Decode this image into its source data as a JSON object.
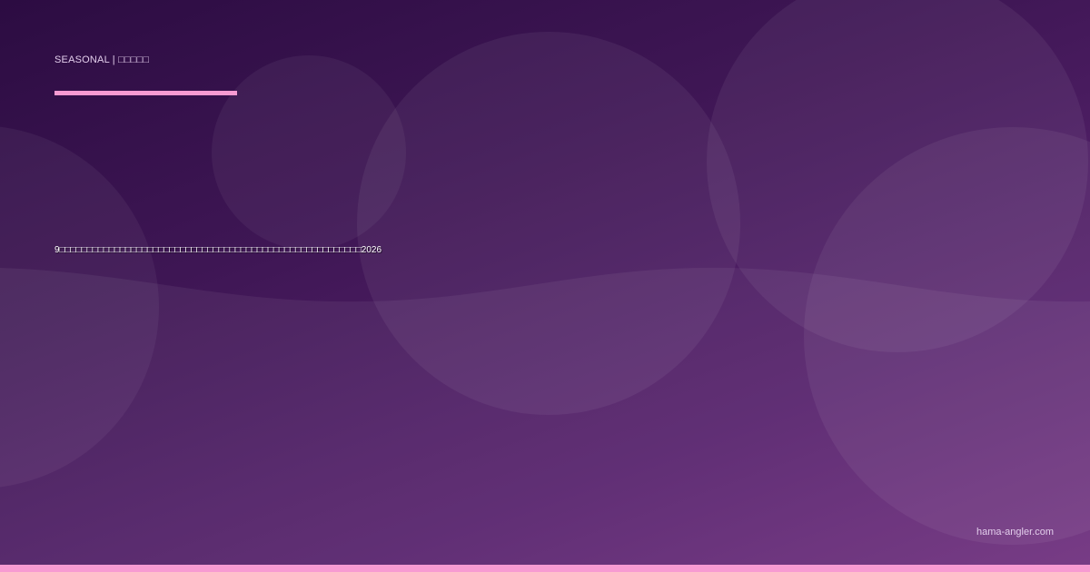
{
  "header": {
    "category": "SEASONAL | □□□□□"
  },
  "main": {
    "headline": "9□□□□□□□□□□□□□□□□□□□□□□□□□□□□□□□□□□□□□□□□□□□□□□□□□□□□□□□2026"
  },
  "footer": {
    "site_url": "hama-angler.com"
  },
  "colors": {
    "accent": "#f79bd2",
    "background_dark": "#2c0c42",
    "background_light": "#70307f",
    "muted_text": "#e2cdeb"
  }
}
